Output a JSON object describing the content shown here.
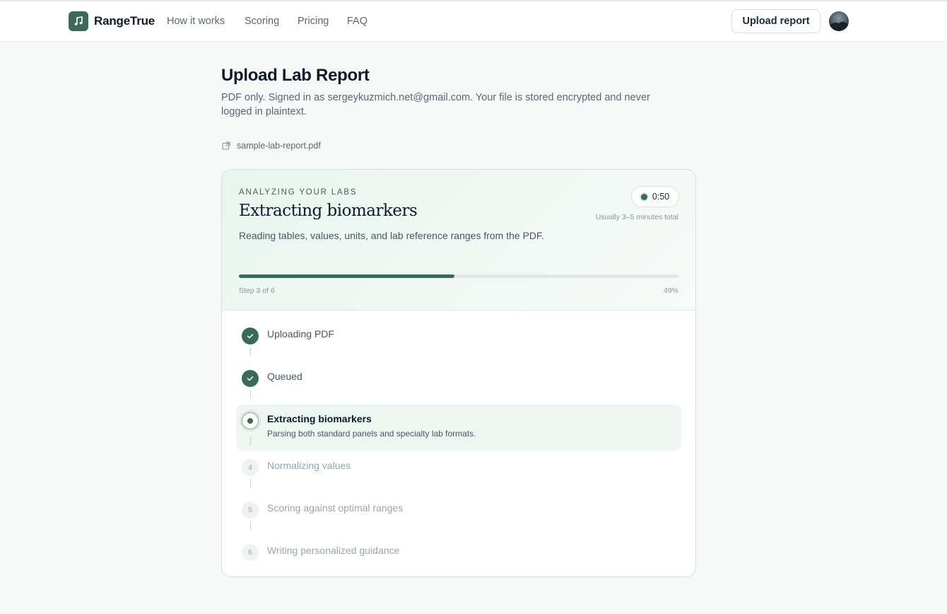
{
  "nav": {
    "brand": "RangeTrue",
    "links": [
      "How it works",
      "Scoring",
      "Pricing",
      "FAQ"
    ],
    "upload_button": "Upload report"
  },
  "page": {
    "title": "Upload Lab Report",
    "subtitle": "PDF only. Signed in as sergeykuzmich.net@gmail.com. Your file is stored encrypted and never logged in plaintext.",
    "file_name": "sample-lab-report.pdf"
  },
  "status": {
    "eyebrow": "ANALYZING YOUR LABS",
    "title": "Extracting biomarkers",
    "description": "Reading tables, values, units, and lab reference ranges from the PDF.",
    "timer": "0:50",
    "timer_note": "Usually 3–5 minutes total",
    "progress": 49,
    "step_label": "Step 3 of 6",
    "percent_label": "49%"
  },
  "steps": [
    {
      "label": "Uploading PDF",
      "state": "done"
    },
    {
      "label": "Queued",
      "state": "done"
    },
    {
      "label": "Extracting biomarkers",
      "state": "active",
      "detail": "Parsing both standard panels and specialty lab formats."
    },
    {
      "label": "Normalizing values",
      "state": "pending",
      "number": "4"
    },
    {
      "label": "Scoring against optimal ranges",
      "state": "pending",
      "number": "5"
    },
    {
      "label": "Writing personalized guidance",
      "state": "pending",
      "number": "6"
    }
  ],
  "colors": {
    "accent": "#3a6b5a",
    "accent_soft": "#eef6f1"
  },
  "icons": {
    "logo": "music-note-icon",
    "file": "external-link-icon",
    "check": "check-icon"
  }
}
